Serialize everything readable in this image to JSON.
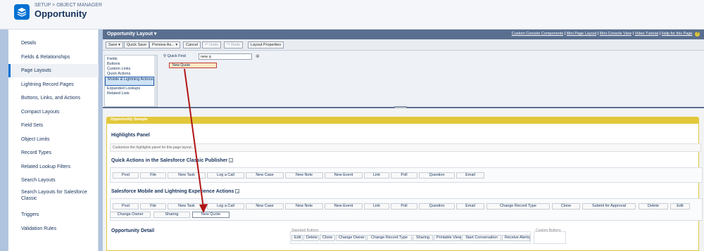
{
  "header": {
    "breadcrumb": "SETUP > OBJECT MANAGER",
    "title": "Opportunity"
  },
  "sidebar": {
    "items": [
      {
        "label": "Details"
      },
      {
        "label": "Fields & Relationships"
      },
      {
        "label": "Page Layouts",
        "active": true
      },
      {
        "label": "Lightning Record Pages"
      },
      {
        "label": "Buttons, Links, and Actions"
      },
      {
        "label": "Compact Layouts"
      },
      {
        "label": "Field Sets"
      },
      {
        "label": "Object Limits"
      },
      {
        "label": "Record Types"
      },
      {
        "label": "Related Lookup Filters"
      },
      {
        "label": "Search Layouts"
      },
      {
        "label": "Search Layouts for Salesforce Classic"
      },
      {
        "label": "Triggers"
      },
      {
        "label": "Validation Rules"
      }
    ]
  },
  "layout": {
    "title": "Opportunity Layout ▾",
    "links": [
      "Custom Console Components",
      "Mini Page Layout",
      "Mini Console View",
      "Video Tutorial",
      "Help for this Page"
    ],
    "link_sep": " | ",
    "help_icon": "?"
  },
  "toolbar": {
    "save": "Save ▾",
    "quick_save": "Quick Save",
    "preview": "Preview As... ▾",
    "cancel": "Cancel",
    "undo": "↶ Undo",
    "redo": "↷ Redo",
    "layout_props": "Layout Properties"
  },
  "palette": {
    "categories": [
      "Fields",
      "Buttons",
      "Custom Links",
      "Quick Actions",
      "Mobile & Lightning Actions",
      "Expanded Lookups",
      "Related Lists"
    ],
    "selected_category": "Mobile & Lightning Actions",
    "quick_find_label": "Quick Find",
    "quick_find_value": "new q",
    "clear_icon": "⊗",
    "result_item": "New Quote"
  },
  "canvas": {
    "sample_label": "Opportunity Sample",
    "highlights_title": "Highlights Panel",
    "highlights_hint": "Customize the highlights panel for this page layout...",
    "classic_title": "Quick Actions in the Salesforce Classic Publisher",
    "classic_actions": [
      "Post",
      "File",
      "New Task",
      "Log a Call",
      "New Case",
      "New Note",
      "New Event",
      "Link",
      "Poll",
      "Question",
      "Email"
    ],
    "lightning_title": "Salesforce Mobile and Lightning Experience Actions",
    "lightning_actions_row1": [
      "Post",
      "File",
      "New Task",
      "Log a Call",
      "New Case",
      "New Note",
      "New Event",
      "Link",
      "Poll",
      "Question",
      "Email",
      "Change Record Type",
      "Clone",
      "Submit for Approval",
      "Delete",
      "Edit"
    ],
    "lightning_actions_row2": [
      "Change Owner",
      "Sharing",
      "New Quote"
    ],
    "detail_title": "Opportunity Detail",
    "standard_buttons_label": "Standard Buttons",
    "custom_buttons_label": "Custom Buttons",
    "standard_buttons": [
      "Edit",
      "Delete",
      "Clone",
      "Change Owner",
      "Change Record Type",
      "Sharing",
      "Printable View",
      "Start Conversation",
      "Receive Alerts"
    ],
    "info_icon": "i"
  },
  "colors": {
    "accent": "#0070d2",
    "layout_bar": "#5a6f8f",
    "sample_bar": "#e2c73b",
    "arrow": "#b01515"
  }
}
